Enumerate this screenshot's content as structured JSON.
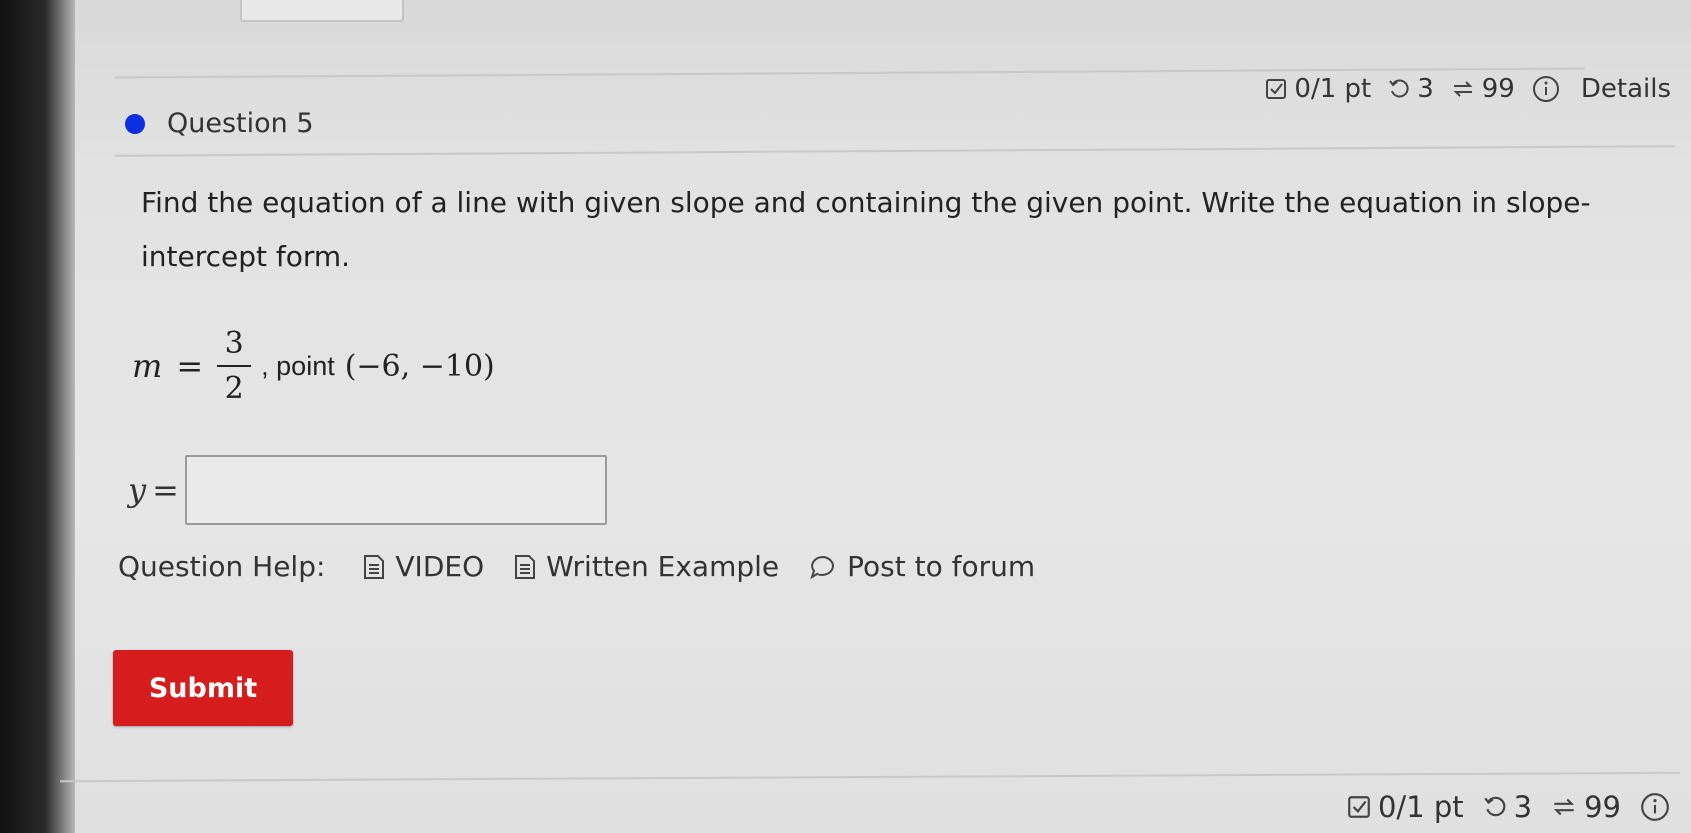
{
  "question": {
    "title": "Question 5",
    "score": "0/1 pt",
    "retries": "3",
    "attempts": "99",
    "details_label": "Details",
    "prompt": "Find the equation of a line with given slope and containing the given point. Write the equation in slope-intercept form.",
    "given": {
      "slope_var": "m",
      "equals": "=",
      "slope_numerator": "3",
      "slope_denominator": "2",
      "point_label": ", point",
      "point_value": "(−6, −10)"
    },
    "answer": {
      "var": "y",
      "equals": "=",
      "value": ""
    }
  },
  "help": {
    "label": "Question Help:",
    "video": "VIDEO",
    "written_example": "Written Example",
    "post_to_forum": "Post to forum"
  },
  "submit_label": "Submit",
  "footer": {
    "score": "0/1 pt",
    "retries": "3",
    "attempts": "99"
  },
  "colors": {
    "submit": "#d61d1d",
    "question_dot": "#0b2ee0"
  },
  "icons": [
    "check-square-icon",
    "retry-icon",
    "attempts-icon",
    "info-icon",
    "document-icon",
    "comment-icon"
  ]
}
